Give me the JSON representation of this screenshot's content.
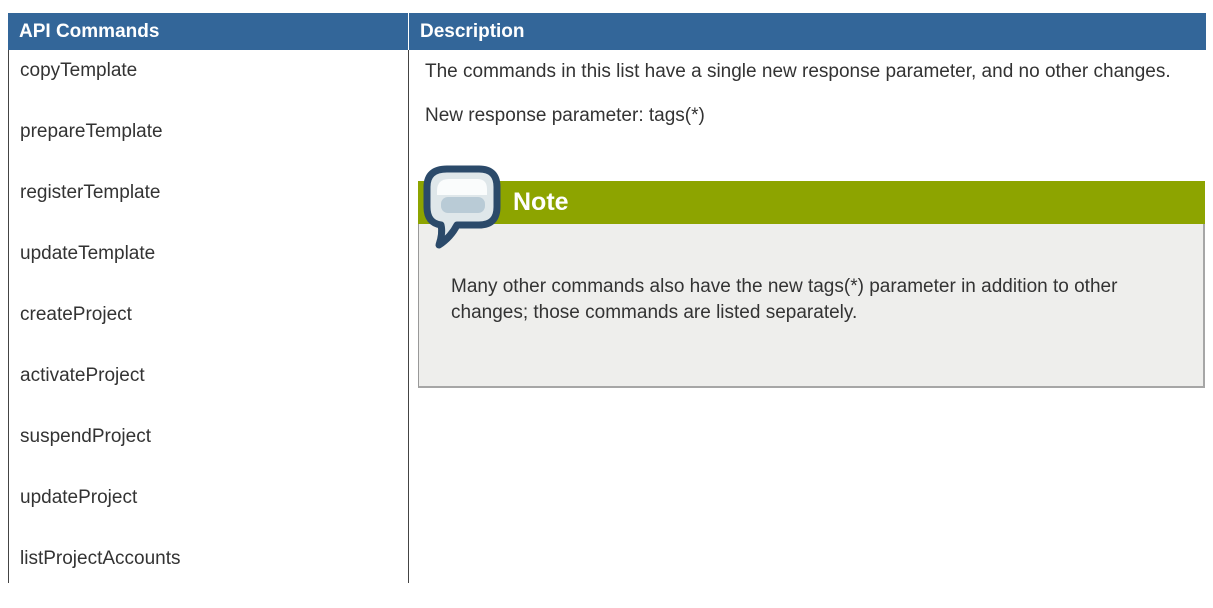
{
  "table": {
    "headers": [
      "API Commands",
      "Description"
    ],
    "commands": [
      "copyTemplate",
      "prepareTemplate",
      "registerTemplate",
      "updateTemplate",
      "createProject",
      "activateProject",
      "suspendProject",
      "updateProject",
      "listProjectAccounts"
    ],
    "description": {
      "paragraph1": "The commands in this list have a single new response parameter, and no other changes.",
      "paragraph2": "New response parameter: tags(*)"
    },
    "note": {
      "icon": "speech-bubble-icon",
      "title": "Note",
      "text": "Many other commands also have the new tags(*) parameter in addition to other changes; those commands are listed separately.",
      "colors": {
        "bar": "#8da400",
        "background": "#eeeeec"
      }
    },
    "colors": {
      "header_background": "#336699",
      "header_text": "#ffffff"
    }
  }
}
